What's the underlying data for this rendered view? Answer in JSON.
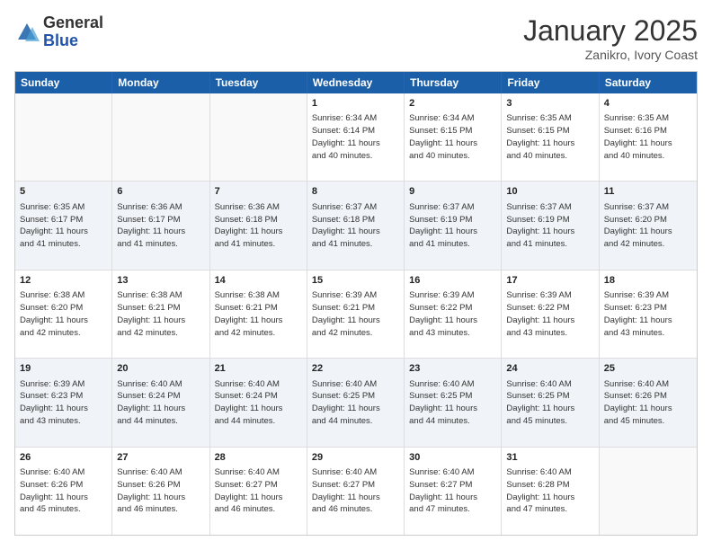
{
  "header": {
    "logo_general": "General",
    "logo_blue": "Blue",
    "title": "January 2025",
    "location": "Zanikro, Ivory Coast"
  },
  "weekdays": [
    "Sunday",
    "Monday",
    "Tuesday",
    "Wednesday",
    "Thursday",
    "Friday",
    "Saturday"
  ],
  "rows": [
    [
      {
        "day": "",
        "info": ""
      },
      {
        "day": "",
        "info": ""
      },
      {
        "day": "",
        "info": ""
      },
      {
        "day": "1",
        "info": "Sunrise: 6:34 AM\nSunset: 6:14 PM\nDaylight: 11 hours\nand 40 minutes."
      },
      {
        "day": "2",
        "info": "Sunrise: 6:34 AM\nSunset: 6:15 PM\nDaylight: 11 hours\nand 40 minutes."
      },
      {
        "day": "3",
        "info": "Sunrise: 6:35 AM\nSunset: 6:15 PM\nDaylight: 11 hours\nand 40 minutes."
      },
      {
        "day": "4",
        "info": "Sunrise: 6:35 AM\nSunset: 6:16 PM\nDaylight: 11 hours\nand 40 minutes."
      }
    ],
    [
      {
        "day": "5",
        "info": "Sunrise: 6:35 AM\nSunset: 6:17 PM\nDaylight: 11 hours\nand 41 minutes."
      },
      {
        "day": "6",
        "info": "Sunrise: 6:36 AM\nSunset: 6:17 PM\nDaylight: 11 hours\nand 41 minutes."
      },
      {
        "day": "7",
        "info": "Sunrise: 6:36 AM\nSunset: 6:18 PM\nDaylight: 11 hours\nand 41 minutes."
      },
      {
        "day": "8",
        "info": "Sunrise: 6:37 AM\nSunset: 6:18 PM\nDaylight: 11 hours\nand 41 minutes."
      },
      {
        "day": "9",
        "info": "Sunrise: 6:37 AM\nSunset: 6:19 PM\nDaylight: 11 hours\nand 41 minutes."
      },
      {
        "day": "10",
        "info": "Sunrise: 6:37 AM\nSunset: 6:19 PM\nDaylight: 11 hours\nand 41 minutes."
      },
      {
        "day": "11",
        "info": "Sunrise: 6:37 AM\nSunset: 6:20 PM\nDaylight: 11 hours\nand 42 minutes."
      }
    ],
    [
      {
        "day": "12",
        "info": "Sunrise: 6:38 AM\nSunset: 6:20 PM\nDaylight: 11 hours\nand 42 minutes."
      },
      {
        "day": "13",
        "info": "Sunrise: 6:38 AM\nSunset: 6:21 PM\nDaylight: 11 hours\nand 42 minutes."
      },
      {
        "day": "14",
        "info": "Sunrise: 6:38 AM\nSunset: 6:21 PM\nDaylight: 11 hours\nand 42 minutes."
      },
      {
        "day": "15",
        "info": "Sunrise: 6:39 AM\nSunset: 6:21 PM\nDaylight: 11 hours\nand 42 minutes."
      },
      {
        "day": "16",
        "info": "Sunrise: 6:39 AM\nSunset: 6:22 PM\nDaylight: 11 hours\nand 43 minutes."
      },
      {
        "day": "17",
        "info": "Sunrise: 6:39 AM\nSunset: 6:22 PM\nDaylight: 11 hours\nand 43 minutes."
      },
      {
        "day": "18",
        "info": "Sunrise: 6:39 AM\nSunset: 6:23 PM\nDaylight: 11 hours\nand 43 minutes."
      }
    ],
    [
      {
        "day": "19",
        "info": "Sunrise: 6:39 AM\nSunset: 6:23 PM\nDaylight: 11 hours\nand 43 minutes."
      },
      {
        "day": "20",
        "info": "Sunrise: 6:40 AM\nSunset: 6:24 PM\nDaylight: 11 hours\nand 44 minutes."
      },
      {
        "day": "21",
        "info": "Sunrise: 6:40 AM\nSunset: 6:24 PM\nDaylight: 11 hours\nand 44 minutes."
      },
      {
        "day": "22",
        "info": "Sunrise: 6:40 AM\nSunset: 6:25 PM\nDaylight: 11 hours\nand 44 minutes."
      },
      {
        "day": "23",
        "info": "Sunrise: 6:40 AM\nSunset: 6:25 PM\nDaylight: 11 hours\nand 44 minutes."
      },
      {
        "day": "24",
        "info": "Sunrise: 6:40 AM\nSunset: 6:25 PM\nDaylight: 11 hours\nand 45 minutes."
      },
      {
        "day": "25",
        "info": "Sunrise: 6:40 AM\nSunset: 6:26 PM\nDaylight: 11 hours\nand 45 minutes."
      }
    ],
    [
      {
        "day": "26",
        "info": "Sunrise: 6:40 AM\nSunset: 6:26 PM\nDaylight: 11 hours\nand 45 minutes."
      },
      {
        "day": "27",
        "info": "Sunrise: 6:40 AM\nSunset: 6:26 PM\nDaylight: 11 hours\nand 46 minutes."
      },
      {
        "day": "28",
        "info": "Sunrise: 6:40 AM\nSunset: 6:27 PM\nDaylight: 11 hours\nand 46 minutes."
      },
      {
        "day": "29",
        "info": "Sunrise: 6:40 AM\nSunset: 6:27 PM\nDaylight: 11 hours\nand 46 minutes."
      },
      {
        "day": "30",
        "info": "Sunrise: 6:40 AM\nSunset: 6:27 PM\nDaylight: 11 hours\nand 47 minutes."
      },
      {
        "day": "31",
        "info": "Sunrise: 6:40 AM\nSunset: 6:28 PM\nDaylight: 11 hours\nand 47 minutes."
      },
      {
        "day": "",
        "info": ""
      }
    ]
  ]
}
